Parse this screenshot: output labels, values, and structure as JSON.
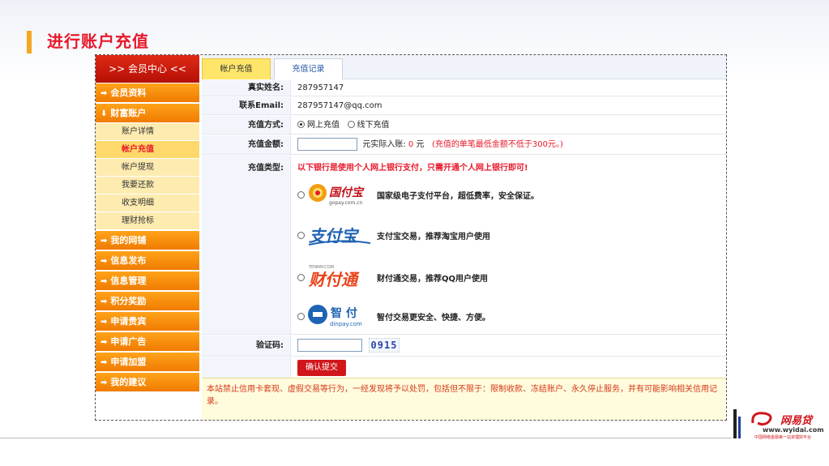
{
  "slide": {
    "title": "进行账户充值"
  },
  "sidebar": {
    "header": ">> 会员中心 <<",
    "items": [
      {
        "label": "会员资料",
        "arrow": "➡"
      },
      {
        "label": "财富账户",
        "arrow": "⬇"
      },
      {
        "label": "账户详情",
        "sub": true
      },
      {
        "label": "帐户充值",
        "sub": true,
        "active": true
      },
      {
        "label": "帐户提现",
        "sub": true
      },
      {
        "label": "我要还款",
        "sub": true
      },
      {
        "label": "收支明细",
        "sub": true
      },
      {
        "label": "理财抢标",
        "sub": true
      },
      {
        "label": "我的网铺",
        "arrow": "➡"
      },
      {
        "label": "信息发布",
        "arrow": "➡"
      },
      {
        "label": "信息管理",
        "arrow": "➡"
      },
      {
        "label": "积分奖励",
        "arrow": "➡"
      },
      {
        "label": "申请贵宾",
        "arrow": "➡"
      },
      {
        "label": "申请广告",
        "arrow": "➡"
      },
      {
        "label": "申请加盟",
        "arrow": "➡"
      },
      {
        "label": "我的建议",
        "arrow": "➡"
      }
    ]
  },
  "tabs": {
    "recharge": "帐户充值",
    "records": "充值记录"
  },
  "form": {
    "real_name_label": "真实姓名:",
    "real_name": "287957147",
    "email_label": "联系Email:",
    "email": "287957147@qq.com",
    "method_label": "充值方式:",
    "method_online": "网上充值",
    "method_offline": "线下充值",
    "amount_label": "充值金额:",
    "amount_value": "",
    "actual_prefix": "元实际入账:",
    "actual_amount": "0",
    "actual_unit": "元",
    "amount_hint": "(充值的单笔最低金额不低于300元。)",
    "type_label": "充值类型:",
    "type_hint": "以下银行是使用个人网上银行支付，只需开通个人网上银行即可!",
    "captcha_label": "验证码:",
    "captcha_value": "",
    "captcha_code": "0915",
    "submit": "确认提交"
  },
  "payments": [
    {
      "logo_text": "国付宝",
      "logo_sub": "gopay.com.cn",
      "desc": "国家级电子支付平台，超低费率，安全保证。",
      "icon": "gopay-logo"
    },
    {
      "logo_text": "支付宝",
      "logo_sub": "",
      "desc": "支付宝交易，推荐淘宝用户使用",
      "icon": "alipay-logo"
    },
    {
      "logo_text": "财付通",
      "logo_sub": "TENPAY.COM",
      "desc": "财付通交易，推荐QQ用户使用",
      "icon": "tenpay-logo"
    },
    {
      "logo_text": "智 付",
      "logo_sub": "dinpay.com",
      "desc": "智付交易更安全、快捷、方便。",
      "icon": "dinpay-logo"
    }
  ],
  "notice": "本站禁止信用卡套现、虚假交易等行为，一经发现将予以处罚，包括但不限于：限制收款、冻结账户、永久停止服务，并有可能影响相关信用记录。",
  "brand": {
    "name": "网易贷",
    "url": "www.wyidai.com",
    "tagline": "中国网络金融第一站资理财平台"
  },
  "colors": {
    "accent_red": "#e8182a",
    "sidebar_orange": "#f07b00",
    "tab_yellow": "#ffe66b"
  }
}
